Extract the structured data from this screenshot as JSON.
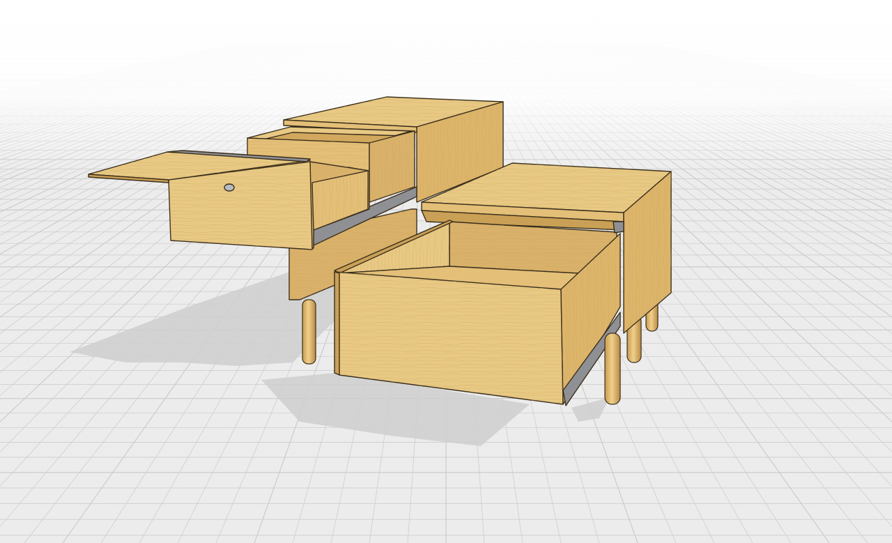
{
  "viewport": {
    "background_color": "#ffffff",
    "floor_color": "#ececec",
    "grid_line_color": "#c9c9c9",
    "shadow_color": "#cfcfcf"
  },
  "model": {
    "wood_light": "#e8c984",
    "wood_mid": "#dcb46a",
    "wood_dark": "#c9a055",
    "wood_interior": "#d9b16a",
    "edge_color": "#3a2e1c",
    "rail_color": "#8f9094",
    "knob_color": "#b8bcc2"
  }
}
